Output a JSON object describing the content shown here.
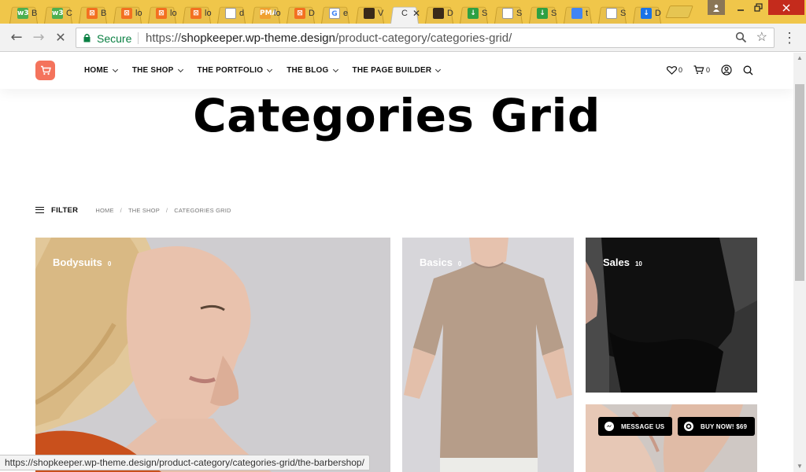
{
  "browser": {
    "tabs": [
      {
        "favicon": "w3schools-icon",
        "fav_color": "#4caf50",
        "fav_glyph": "w3",
        "text": "B"
      },
      {
        "favicon": "w3schools-icon",
        "fav_color": "#4caf50",
        "fav_glyph": "w3",
        "text": "C"
      },
      {
        "favicon": "xampp-icon",
        "fav_color": "#f37021",
        "fav_glyph": "⊠",
        "text": "B"
      },
      {
        "favicon": "xampp-icon",
        "fav_color": "#f37021",
        "fav_glyph": "⊠",
        "text": "lo"
      },
      {
        "favicon": "xampp-icon",
        "fav_color": "#f37021",
        "fav_glyph": "⊠",
        "text": "lo"
      },
      {
        "favicon": "xampp-icon",
        "fav_color": "#f37021",
        "fav_glyph": "⊠",
        "text": "lo"
      },
      {
        "favicon": "document-icon",
        "fav_color": "#ffffff",
        "fav_glyph": "",
        "text": "d"
      },
      {
        "favicon": "phpmyadmin-icon",
        "fav_color": "#f0a030",
        "fav_glyph": "PMA",
        "text": "lo"
      },
      {
        "favicon": "xampp-icon",
        "fav_color": "#f37021",
        "fav_glyph": "⊠",
        "text": "D"
      },
      {
        "favicon": "google-icon",
        "fav_color": "#ffffff",
        "fav_glyph": "G",
        "text": "e"
      },
      {
        "favicon": "image-icon",
        "fav_color": "#3a2a1a",
        "fav_glyph": "",
        "text": "V"
      },
      {
        "favicon": "active-tab",
        "fav_color": "#f2f2f2",
        "fav_glyph": "",
        "text": "C",
        "active": true
      },
      {
        "favicon": "image-icon",
        "fav_color": "#3a2a1a",
        "fav_glyph": "",
        "text": "D"
      },
      {
        "favicon": "download-icon",
        "fav_color": "#2ea043",
        "fav_glyph": "↓",
        "text": "S"
      },
      {
        "favicon": "document-icon",
        "fav_color": "#ffffff",
        "fav_glyph": "",
        "text": "S"
      },
      {
        "favicon": "download-icon",
        "fav_color": "#2ea043",
        "fav_glyph": "↓",
        "text": "S"
      },
      {
        "favicon": "docs-icon",
        "fav_color": "#4285f4",
        "fav_glyph": "",
        "text": "t"
      },
      {
        "favicon": "document-icon",
        "fav_color": "#ffffff",
        "fav_glyph": "",
        "text": "S"
      },
      {
        "favicon": "download-arrow-icon",
        "fav_color": "#1a73e8",
        "fav_glyph": "↓",
        "text": "D"
      }
    ],
    "secure_label": "Secure",
    "url_scheme": "https://",
    "url_host": "shopkeeper.wp-theme.design",
    "url_path": "/product-category/categories-grid/",
    "status_url": "https://shopkeeper.wp-theme.design/product-category/categories-grid/the-barbershop/"
  },
  "site": {
    "nav": [
      {
        "label": "HOME"
      },
      {
        "label": "THE SHOP"
      },
      {
        "label": "THE PORTFOLIO"
      },
      {
        "label": "THE BLOG"
      },
      {
        "label": "THE PAGE BUILDER"
      }
    ],
    "wishlist_count": "0",
    "cart_count": "0",
    "page_title": "Categories Grid",
    "filter_label": "FILTER",
    "breadcrumbs": [
      "HOME",
      "THE SHOP",
      "CATEGORIES GRID"
    ],
    "categories": [
      {
        "name": "Bodysuits",
        "count": "0"
      },
      {
        "name": "Basics",
        "count": "0"
      },
      {
        "name": "Sales",
        "count": "10"
      }
    ],
    "message_button": "MESSAGE US",
    "buy_button": "BUY NOW! $69",
    "colors": {
      "logo_bg": "#f4735c",
      "title": "#000000",
      "float_bg": "#000000"
    }
  }
}
